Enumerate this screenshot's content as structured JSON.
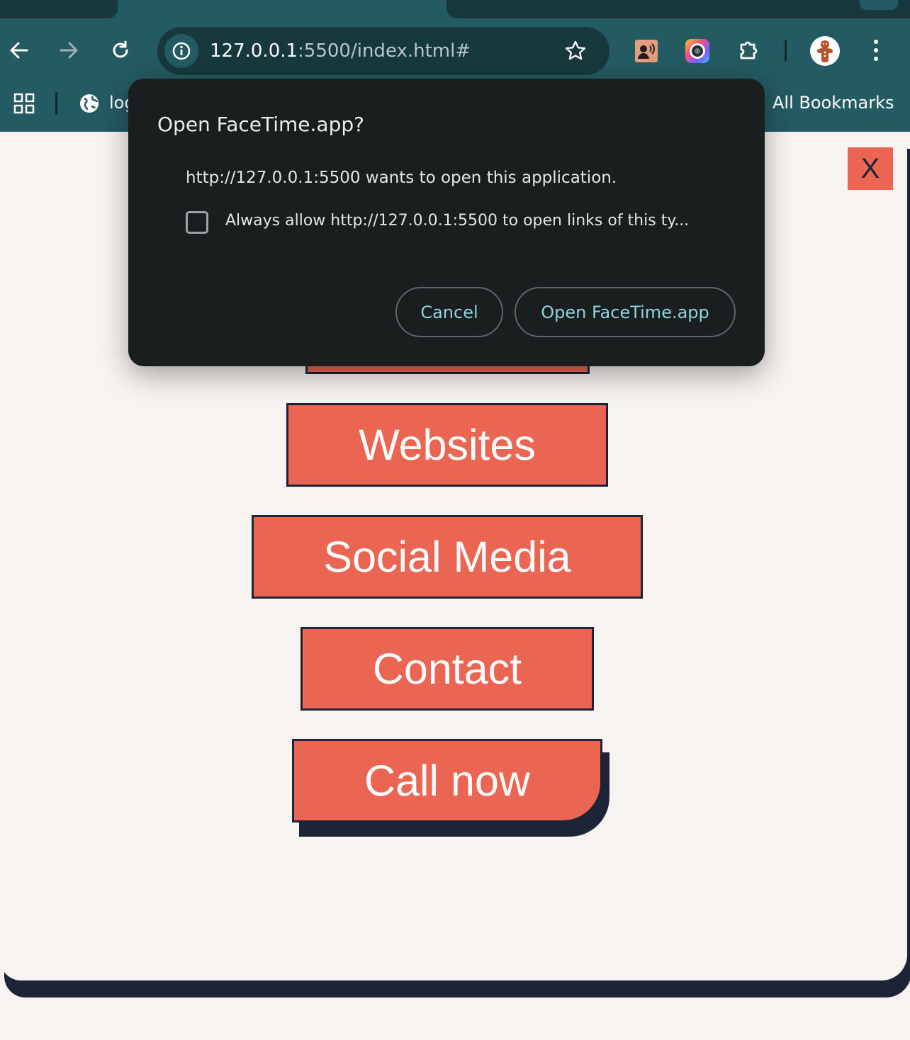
{
  "browser": {
    "url_host": "127.0.0.1",
    "url_rest": ":5500/index.html#",
    "bookmarks": {
      "first_item": "log",
      "all_bookmarks": "All Bookmarks"
    },
    "icons": [
      "back-arrow-icon",
      "forward-arrow-icon",
      "reload-icon",
      "site-info-icon",
      "bookmark-star-icon",
      "extension-voice-icon",
      "extension-camera-icon",
      "extensions-puzzle-icon",
      "profile-avatar-icon",
      "kebab-menu-icon",
      "apps-grid-icon",
      "globe-icon"
    ]
  },
  "page": {
    "close_label": "X",
    "menu_items": [
      "Websites",
      "Social Media",
      "Contact"
    ],
    "call_label": "Call now",
    "colors": {
      "button": "#eb6652",
      "border": "#1e2438",
      "background": "#f7f3f0"
    }
  },
  "dialog": {
    "title": "Open FaceTime.app?",
    "message": "http://127.0.0.1:5500 wants to open this application.",
    "checkbox_label": "Always allow http://127.0.0.1:5500 to open links of this ty...",
    "cancel_label": "Cancel",
    "open_label": "Open FaceTime.app",
    "accent": "#8fd3e0"
  }
}
